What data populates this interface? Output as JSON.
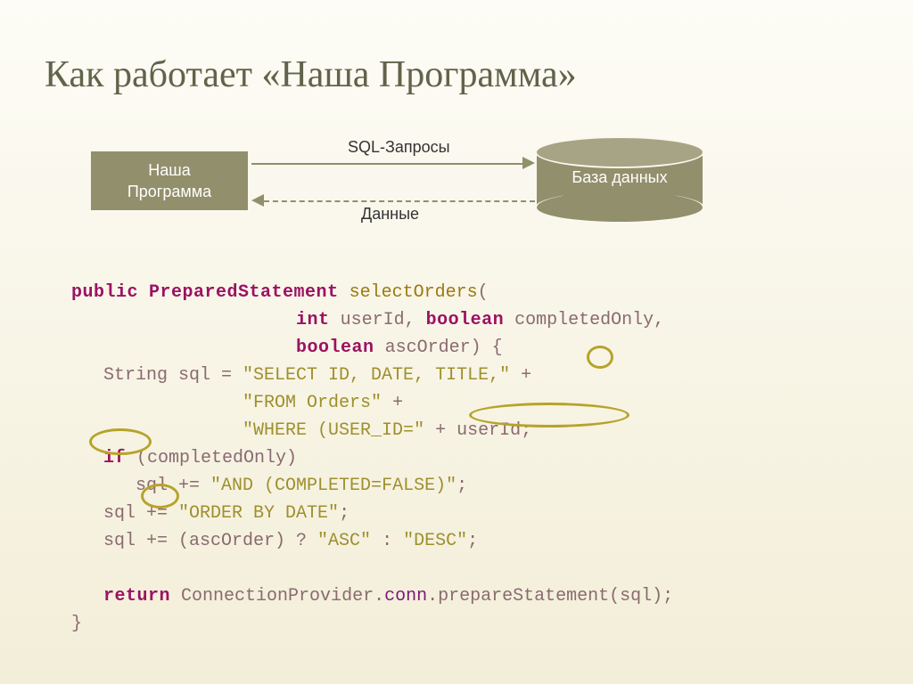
{
  "title": "Как работает «Наша Программа»",
  "diagram": {
    "program_box": "Наша\nПрограмма",
    "database_cyl": "База данных",
    "arrow_top_label": "SQL-Запросы",
    "arrow_bottom_label": "Данные"
  },
  "code": {
    "l1_kw": "public",
    "l1_type": "PreparedStatement",
    "l1_method": "selectOrders",
    "l2_int": "int",
    "l2_p1": " userId, ",
    "l2_bool": "boolean",
    "l2_p2": " completedOnly,",
    "l3_bool": "boolean",
    "l3_p1": " ascOrder) {",
    "l4_a": "   String sql = ",
    "l4_s": "\"SELECT ID, DATE, TITLE,\"",
    "l4_p": " +",
    "l5_s": "\"FROM Orders\"",
    "l5_p": " +",
    "l6_s": "\"WHERE (USER_ID=\"",
    "l6_p": " + userId;",
    "l7_kw": "if",
    "l7_b": " (completedOnly)",
    "l8_a": "      sql += ",
    "l8_s": "\"AND (COMPLETED=FALSE)\"",
    "l8_p": ";",
    "l9_a": "   sql += ",
    "l9_s": "\"ORDER BY DATE\"",
    "l9_p": ";",
    "l10_a": "   sql += (ascOrder) ? ",
    "l10_s1": "\"ASC\"",
    "l10_b": " : ",
    "l10_s2": "\"DESC\"",
    "l10_p": ";",
    "l12_kw": "return",
    "l12_a": " ConnectionProvider.",
    "l12_f": "conn",
    "l12_b": ".prepareStatement(sql);",
    "l13": "}"
  }
}
